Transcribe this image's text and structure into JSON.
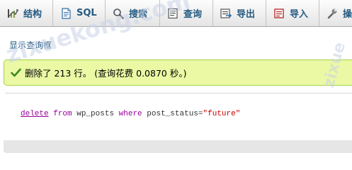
{
  "tabs": [
    {
      "label": "结构",
      "icon": "structure-icon"
    },
    {
      "label": "SQL",
      "icon": "sql-document-icon"
    },
    {
      "label": "搜索",
      "icon": "search-icon"
    },
    {
      "label": "查询",
      "icon": "query-icon"
    },
    {
      "label": "导出",
      "icon": "export-icon"
    },
    {
      "label": "导入",
      "icon": "import-icon"
    },
    {
      "label": "操",
      "icon": "wrench-icon"
    }
  ],
  "toggle_link": "显示查询框",
  "message": {
    "text": "删除了 213 行。 (查询花费 0.0870 秒。)",
    "icon": "success-check-icon",
    "color": "#ebf8a4"
  },
  "sql": {
    "delete": "delete",
    "from": "from",
    "table": "wp_posts",
    "where": "where",
    "column": "post_status",
    "op": "=",
    "value": "\"future\""
  },
  "watermark": {
    "main": "zixuekong.com",
    "side": "zixue"
  },
  "colors": {
    "link": "#235a81",
    "keyword": "#990099",
    "string": "#cc0000",
    "success_bg": "#ebf8a4",
    "success_border": "#a2d246"
  }
}
